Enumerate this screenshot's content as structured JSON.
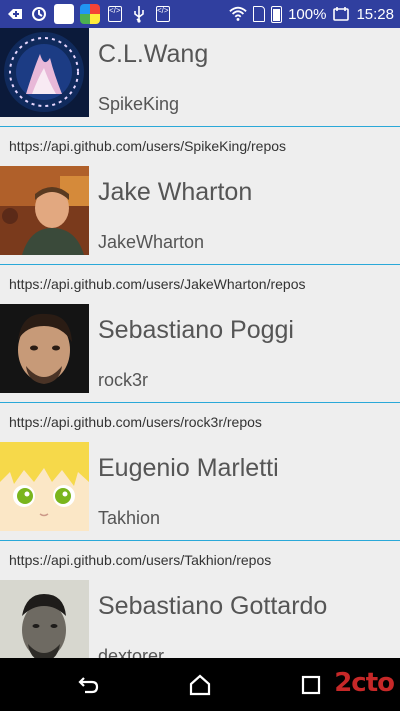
{
  "status_bar": {
    "battery": "100%",
    "time": "15:28"
  },
  "users": [
    {
      "name": "C.L.Wang",
      "login": "SpikeKing",
      "repos_url": "https://api.github.com/users/SpikeKing/repos"
    },
    {
      "name": "Jake Wharton",
      "login": "JakeWharton",
      "repos_url": "https://api.github.com/users/JakeWharton/repos"
    },
    {
      "name": "Sebastiano Poggi",
      "login": "rock3r",
      "repos_url": "https://api.github.com/users/rock3r/repos"
    },
    {
      "name": "Eugenio Marletti",
      "login": "Takhion",
      "repos_url": "https://api.github.com/users/Takhion/repos"
    },
    {
      "name": "Sebastiano Gottardo",
      "login": "dextorer",
      "repos_url": ""
    }
  ],
  "nav": {
    "watermark": "2cto"
  },
  "colors": {
    "status_bar": "#303f9f",
    "divider": "#2aa8d8",
    "background": "#eeeeee"
  }
}
